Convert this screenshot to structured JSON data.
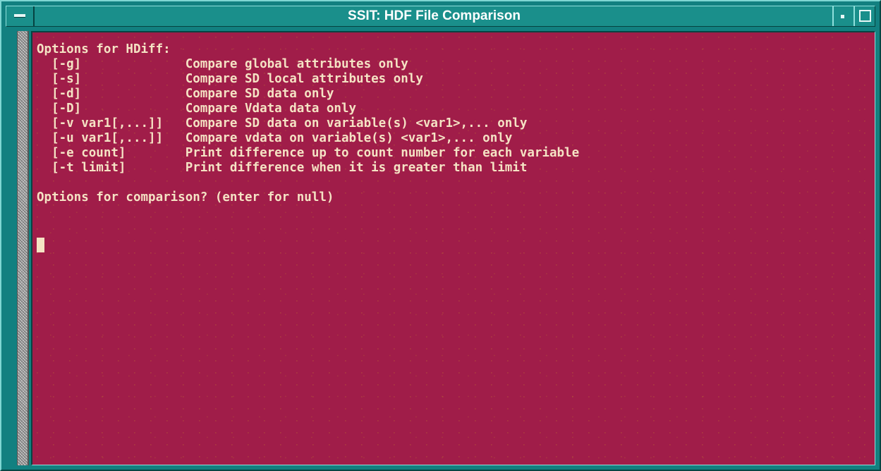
{
  "window": {
    "title": "SSIT: HDF File Comparison"
  },
  "terminal": {
    "header": "Options for HDiff:",
    "options": [
      {
        "flag": "[-g]",
        "desc": "Compare global attributes only"
      },
      {
        "flag": "[-s]",
        "desc": "Compare SD local attributes only"
      },
      {
        "flag": "[-d]",
        "desc": "Compare SD data only"
      },
      {
        "flag": "[-D]",
        "desc": "Compare Vdata data only"
      },
      {
        "flag": "[-v var1[,...]]",
        "desc": "Compare SD data on variable(s) <var1>,... only"
      },
      {
        "flag": "[-u var1[,...]]",
        "desc": "Compare vdata on variable(s) <var1>,... only"
      },
      {
        "flag": "[-e count]",
        "desc": "Print difference up to count number for each variable"
      },
      {
        "flag": "[-t limit]",
        "desc": "Print difference when it is greater than limit"
      }
    ],
    "prompt": "Options for comparison? (enter for null)"
  },
  "colors": {
    "terminal_bg": "#a01d49",
    "terminal_fg": "#f5e3c4",
    "window_frame": "#128080",
    "titlebar": "#1a8f8b"
  },
  "icons": {
    "window_menu": "window-menu-icon",
    "minimize": "minimize-icon",
    "maximize": "maximize-icon"
  }
}
